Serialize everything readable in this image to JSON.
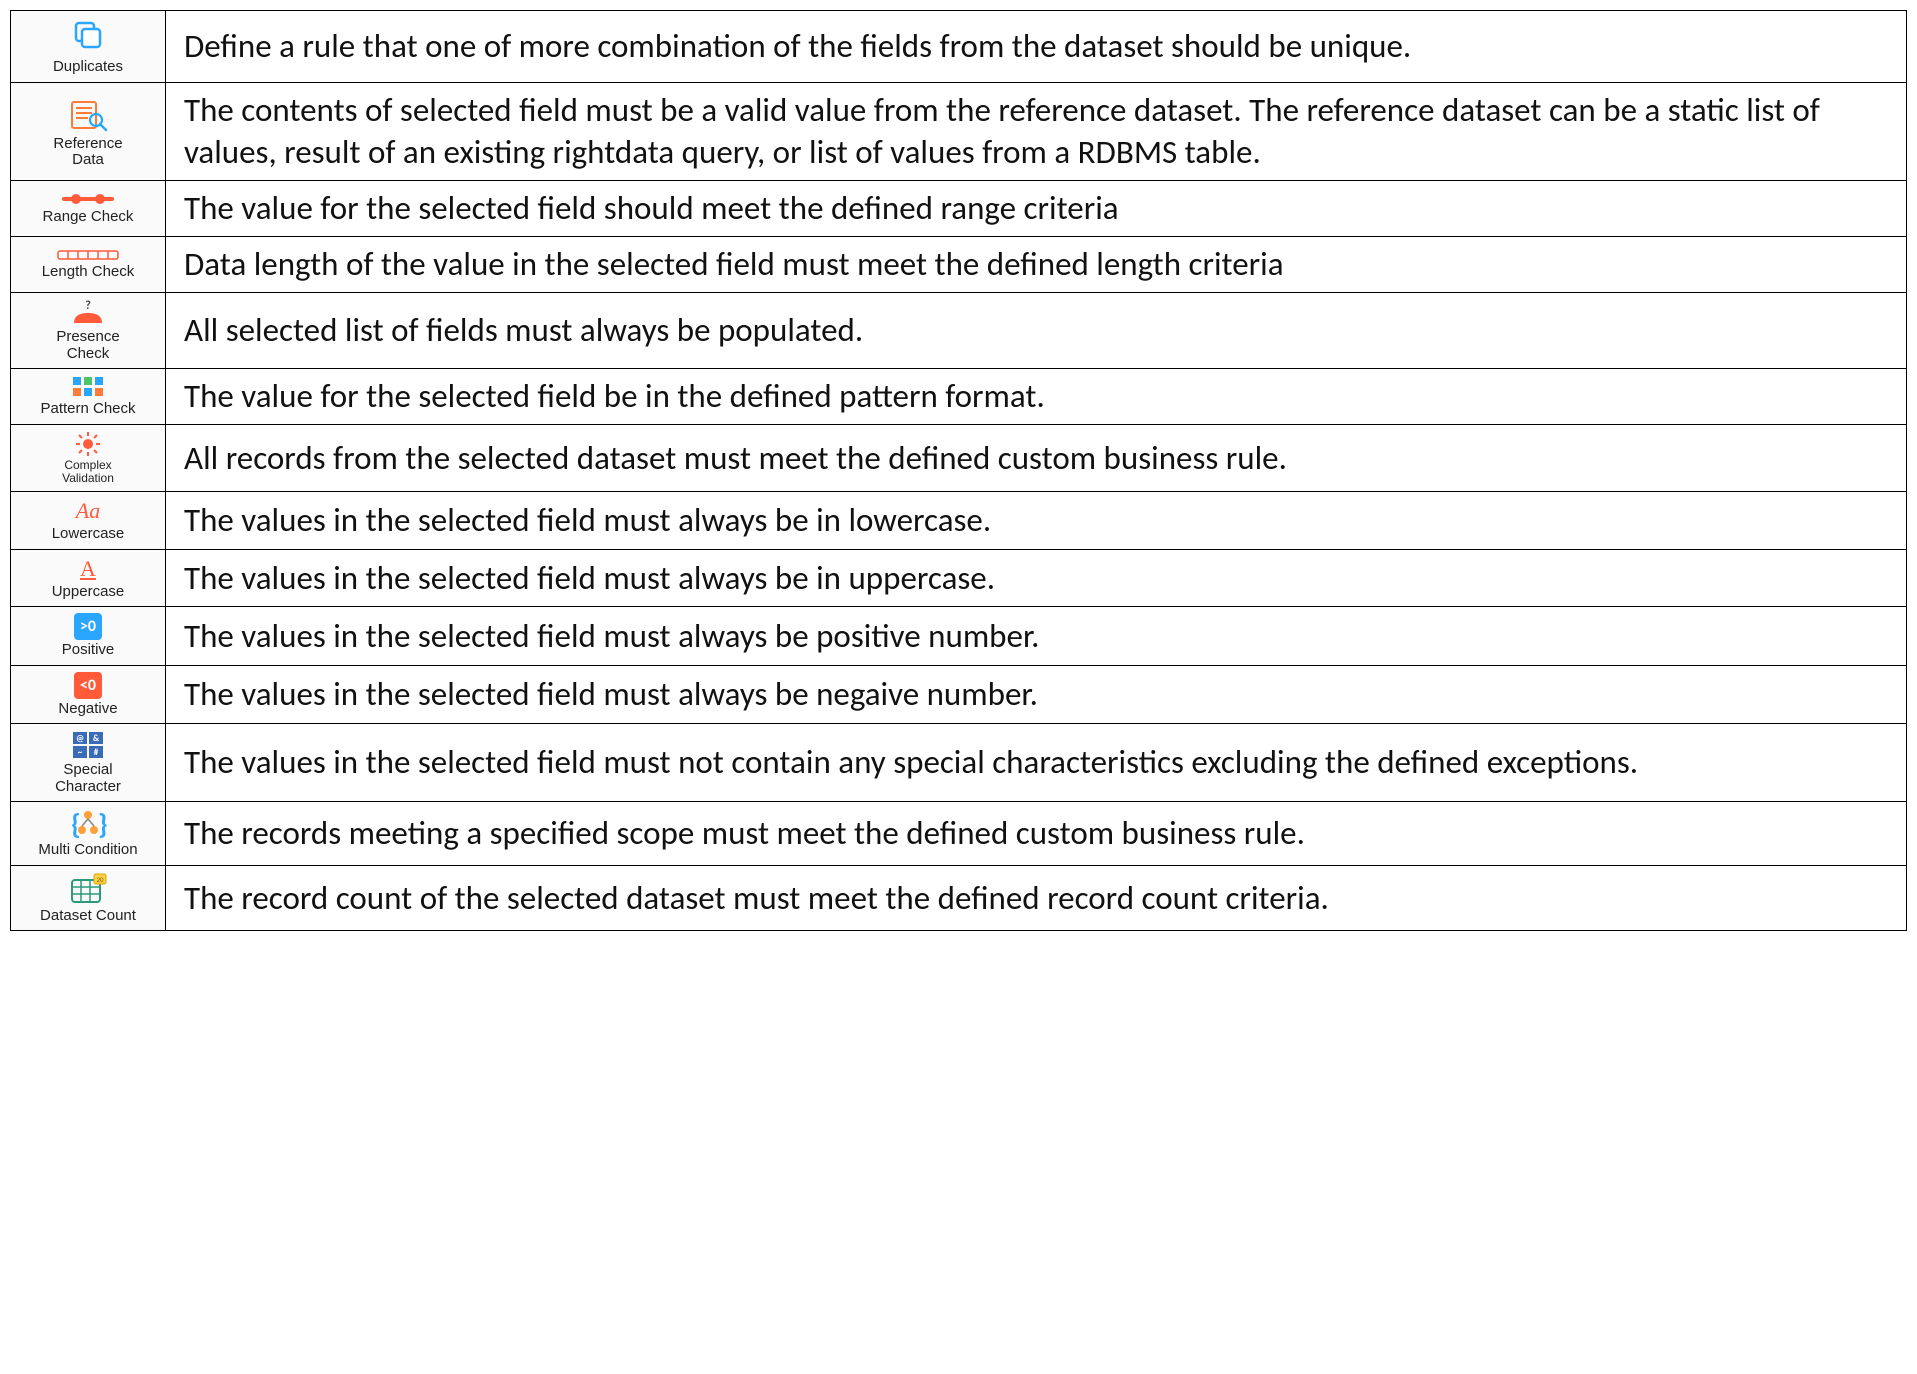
{
  "rows": [
    {
      "label": "Duplicates",
      "desc": "Define a rule that one of more combination of the fields from the dataset should be unique."
    },
    {
      "label": "Reference Data",
      "desc": "The contents of selected field must be a valid value from the reference dataset. The reference dataset can be a static list of values, result of an existing rightdata query, or list of values from a RDBMS table."
    },
    {
      "label": "Range Check",
      "desc": "The value for the selected field should meet the defined range criteria"
    },
    {
      "label": "Length Check",
      "desc": "Data length of the value in the selected field must meet the defined length criteria"
    },
    {
      "label": "Presence Check",
      "desc": "All selected list of fields must always be populated."
    },
    {
      "label": "Pattern Check",
      "desc": "The value for the selected field be in the defined pattern format."
    },
    {
      "label": "Complex Validation",
      "desc": "All records from the selected dataset must meet the defined custom business rule."
    },
    {
      "label": "Lowercase",
      "desc": "The values in the selected field must always be in lowercase."
    },
    {
      "label": "Uppercase",
      "desc": "The values in the selected field must always be in uppercase."
    },
    {
      "label": "Positive",
      "desc": "The values in the selected field must always be positive number."
    },
    {
      "label": "Negative",
      "desc": "The values in the selected field must always be negaive number."
    },
    {
      "label": "Special Character",
      "desc": "The values in the selected field must not contain any special characteristics excluding the defined exceptions."
    },
    {
      "label": "Multi Condition",
      "desc": "The records meeting a specified scope must meet the defined custom business rule."
    },
    {
      "label": "Dataset Count",
      "desc": "The record count of the selected dataset must meet the defined record count criteria."
    }
  ]
}
